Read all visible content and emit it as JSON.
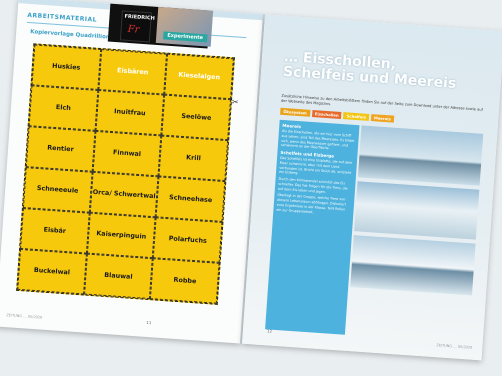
{
  "left_page": {
    "kicker": "ARBEITSMATERIAL",
    "subheading": "Kopiervorlage Quadrillionen",
    "cells": [
      "Huskies",
      "Eisbären",
      "Kieselalgen",
      "Elch",
      "Inuitfrau",
      "Seelöwe",
      "Rentier",
      "Finnwal",
      "Krill",
      "Schneeeule",
      "Orca/ Schwertwal",
      "Schneehase",
      "Eisbär",
      "Kaiserpinguin",
      "Polarfuchs",
      "Buckelwal",
      "Blauwal",
      "Robbe"
    ],
    "page_number": "11",
    "footer": "ZEITUNG … 05/2020"
  },
  "magazine": {
    "logo_line1": "FRIEDRICH",
    "logo_mark": "Fr",
    "badge": "Experimente"
  },
  "right_page": {
    "title_line1": "… Eisschollen,",
    "title_line2": "Schelfeis und Meereis",
    "intro": "Zusätzliche Hinweise zu den Arbeitsblättern finden Sie auf der Seite zum Download unter der Adresse sowie auf der Webseite des Magazins.",
    "tabs": [
      "Ökosystem",
      "Eisschollen",
      "Schelfeis",
      "Meereis"
    ],
    "tab_colors": [
      "#e9a21b",
      "#e86a2b",
      "#f2c614",
      "#f0a31e"
    ],
    "blocks": [
      {
        "heading": "Meereis",
        "text": "Als die Eisschollen, die wir hier vom Schiff aus sehen, sind Teil des Meereises. Es bildet sich, wenn das Meerwasser gefriert, und schwimmt an der Oberfläche."
      },
      {
        "heading": "Schelfeis und Eisberge",
        "text": "Das Schelfeis ist eine Eisplatte, die auf dem Meer schwimmt, aber mit dem Land verbunden ist. Bricht ein Stück ab, entsteht ein Eisberg."
      },
      {
        "heading": "",
        "text": "Durch den Klimawandel schmilzt das Eis schneller. Das hat Folgen für die Tiere, die auf dem Eis leben und jagen."
      },
      {
        "heading": "",
        "text": "Überlegt in der Gruppe, welche Tiere von diesem Lebensraum abhängen. Diskutiert eure Ergebnisse in der Klasse. Teilt Rollen ein zur Gruppenarbeit."
      }
    ],
    "page_number": "12",
    "footer": "ZEITUNG … 05/2020"
  }
}
